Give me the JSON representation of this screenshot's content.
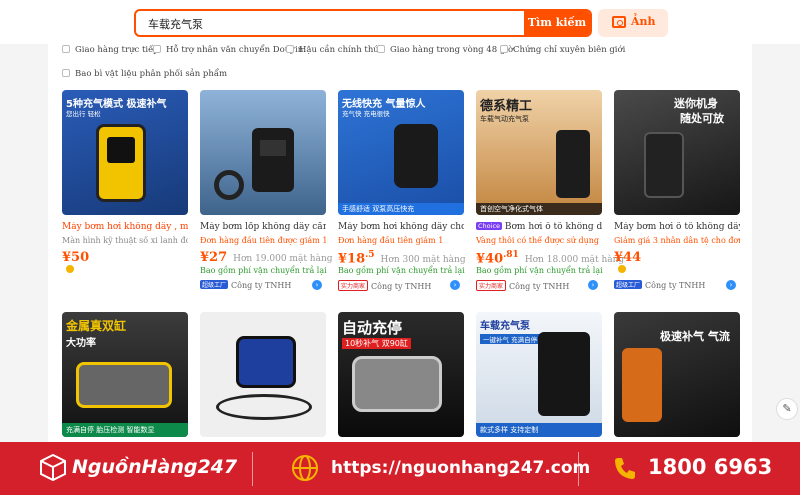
{
  "search": {
    "query": "车载充气泵",
    "button": "Tìm kiếm",
    "image_button": "Ảnh"
  },
  "filters": [
    "Giao hàng trực tiếp",
    "Hỗ trợ nhân văn chuyển Douyin.",
    "Hậu cần chính thức",
    "Giao hàng trong vòng 48 giờ",
    "Chứng chỉ xuyên biên giới",
    "Bao bì vật liệu phân phối sản phẩm"
  ],
  "products": [
    {
      "img_t1": "5种充气模式 极速补气",
      "img_t2": "您出行 轻松",
      "img_bar": "",
      "title": "Máy bơm hơi không dây , máy",
      "title_red": true,
      "sub": "Màn hình kỹ thuật số xi lanh đơn",
      "sub_grey": true,
      "price": "¥50",
      "price_dec": "",
      "sold": "",
      "ship": "",
      "company": "",
      "tag": "",
      "gold": true,
      "color": "#1f4fa0"
    },
    {
      "img_t1": "",
      "img_t2": "",
      "img_bar": "",
      "title": "Máy bơm lốp không dây cầm t",
      "title_red": false,
      "sub": "Đơn hàng đầu tiên được giảm 1",
      "sub_grey": false,
      "price": "¥27",
      "price_dec": "",
      "sold": "Hơn 19.000 mặt hàng",
      "ship": "Bao gồm phí vận chuyển trả lại",
      "company": "Công ty TNHH",
      "tag": "超级工厂",
      "tag_blue": true,
      "gold": false,
      "color": "#5a7fa8"
    },
    {
      "img_t1": "无线快充 气量惊人",
      "img_t2": "充气快 充电很快",
      "img_bar": "手感舒适  双泵高压快充",
      "title": "Máy bơm hơi không dây cho ô",
      "title_red": false,
      "sub": "Đơn hàng đầu tiên giảm 1",
      "sub_grey": false,
      "price": "¥18",
      "price_dec": ".5",
      "sold": "Hơn 300 mặt hàng",
      "ship": "Bao gồm phí vận chuyển trả lại",
      "company": "Công ty TNHH",
      "tag": "实力商家",
      "tag_blue": false,
      "gold": false,
      "color": "#1e63c8"
    },
    {
      "img_t1": "德系精工",
      "img_t2": "车载气动充气泵",
      "img_bar": "首创空气净化式气体",
      "title": "Bơm hơi ô tô không dây",
      "choice": "Choice",
      "title_red": false,
      "sub": "Vàng thôi có thể được sử dụng để",
      "sub_grey": false,
      "price": "¥40",
      "price_dec": ".81",
      "sold": "Hơn 18.000 mặt hàng",
      "ship": "Bao gồm phí vận chuyển trả lại",
      "company": "Công ty TNHH",
      "tag": "实力商家",
      "tag_blue": false,
      "gold": false,
      "color": "#c98a45"
    },
    {
      "img_t1": "迷你机身",
      "img_t2": "随处可放",
      "img_bar": "",
      "title": "Máy bơm hơi ô tô không dây c",
      "title_red": false,
      "sub": "Giảm giá 3 nhân dân tệ cho đơn",
      "sub_grey": false,
      "price": "¥44",
      "price_dec": "",
      "sold": "",
      "ship": "",
      "company": "Công ty TNHH",
      "tag": "超级工厂",
      "tag_blue": true,
      "gold": true,
      "color": "#2b2b2b"
    },
    {
      "img_t1": "金属真双缸",
      "img_t2": "大功率",
      "img_bar": "充满自停  胎压检测  智能数显",
      "title": "",
      "color": "#303030"
    },
    {
      "img_t1": "",
      "img_t2": "",
      "img_bar": "",
      "title": "",
      "color": "#e8e8e8"
    },
    {
      "img_t1": "自动充停",
      "img_t2": "10秒补气 双90缸",
      "img_bar": "",
      "title": "",
      "color": "#1a1a1a"
    },
    {
      "img_t1": "车载充气泵",
      "img_t2": "一键补气  充满自停",
      "img_bar": "款式多样 支持定制",
      "title": "",
      "color": "#e9eef4"
    },
    {
      "img_t1": "极速补气 气流",
      "img_t2": "",
      "img_bar": "",
      "title": "",
      "color": "#222"
    }
  ],
  "footer": {
    "brand": "NguồnHàng247",
    "url": "https://nguonhang247.com",
    "phone": "1800 6963"
  },
  "colors": {
    "accent": "#ff5000",
    "footer_bg": "#d4202a",
    "ship_green": "#2e9c2e"
  }
}
